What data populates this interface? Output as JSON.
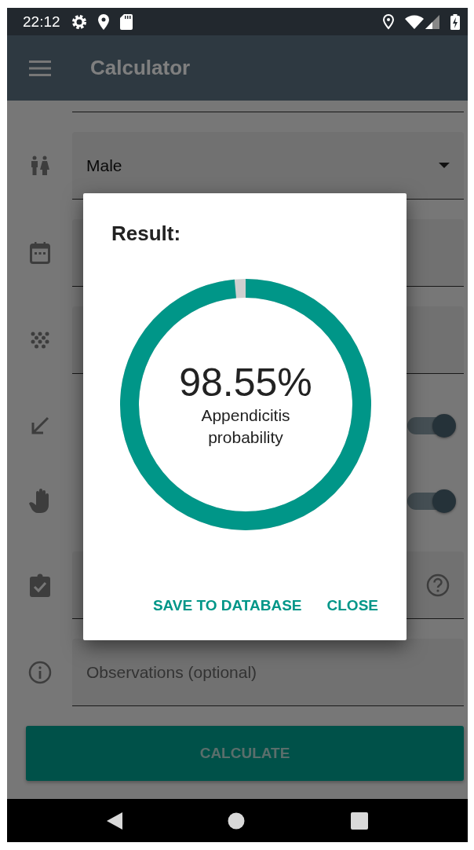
{
  "status_bar": {
    "time": "22:12"
  },
  "app_bar": {
    "title": "Calculator"
  },
  "form": {
    "rows": [
      {
        "kind": "dropdown",
        "value": "Male"
      },
      {
        "kind": "text"
      },
      {
        "kind": "text"
      },
      {
        "kind": "switch",
        "on": true
      },
      {
        "kind": "switch",
        "on": true
      },
      {
        "kind": "help"
      },
      {
        "kind": "text",
        "placeholder": "Observations (optional)"
      }
    ]
  },
  "calculate_button": "CALCULATE",
  "dialog": {
    "title": "Result:",
    "result": {
      "level": 0.9855,
      "value": "98.55%",
      "caption": "Appendicitis probability"
    },
    "buttons": [
      "SAVE TO DATABASE",
      "CLOSE"
    ]
  }
}
